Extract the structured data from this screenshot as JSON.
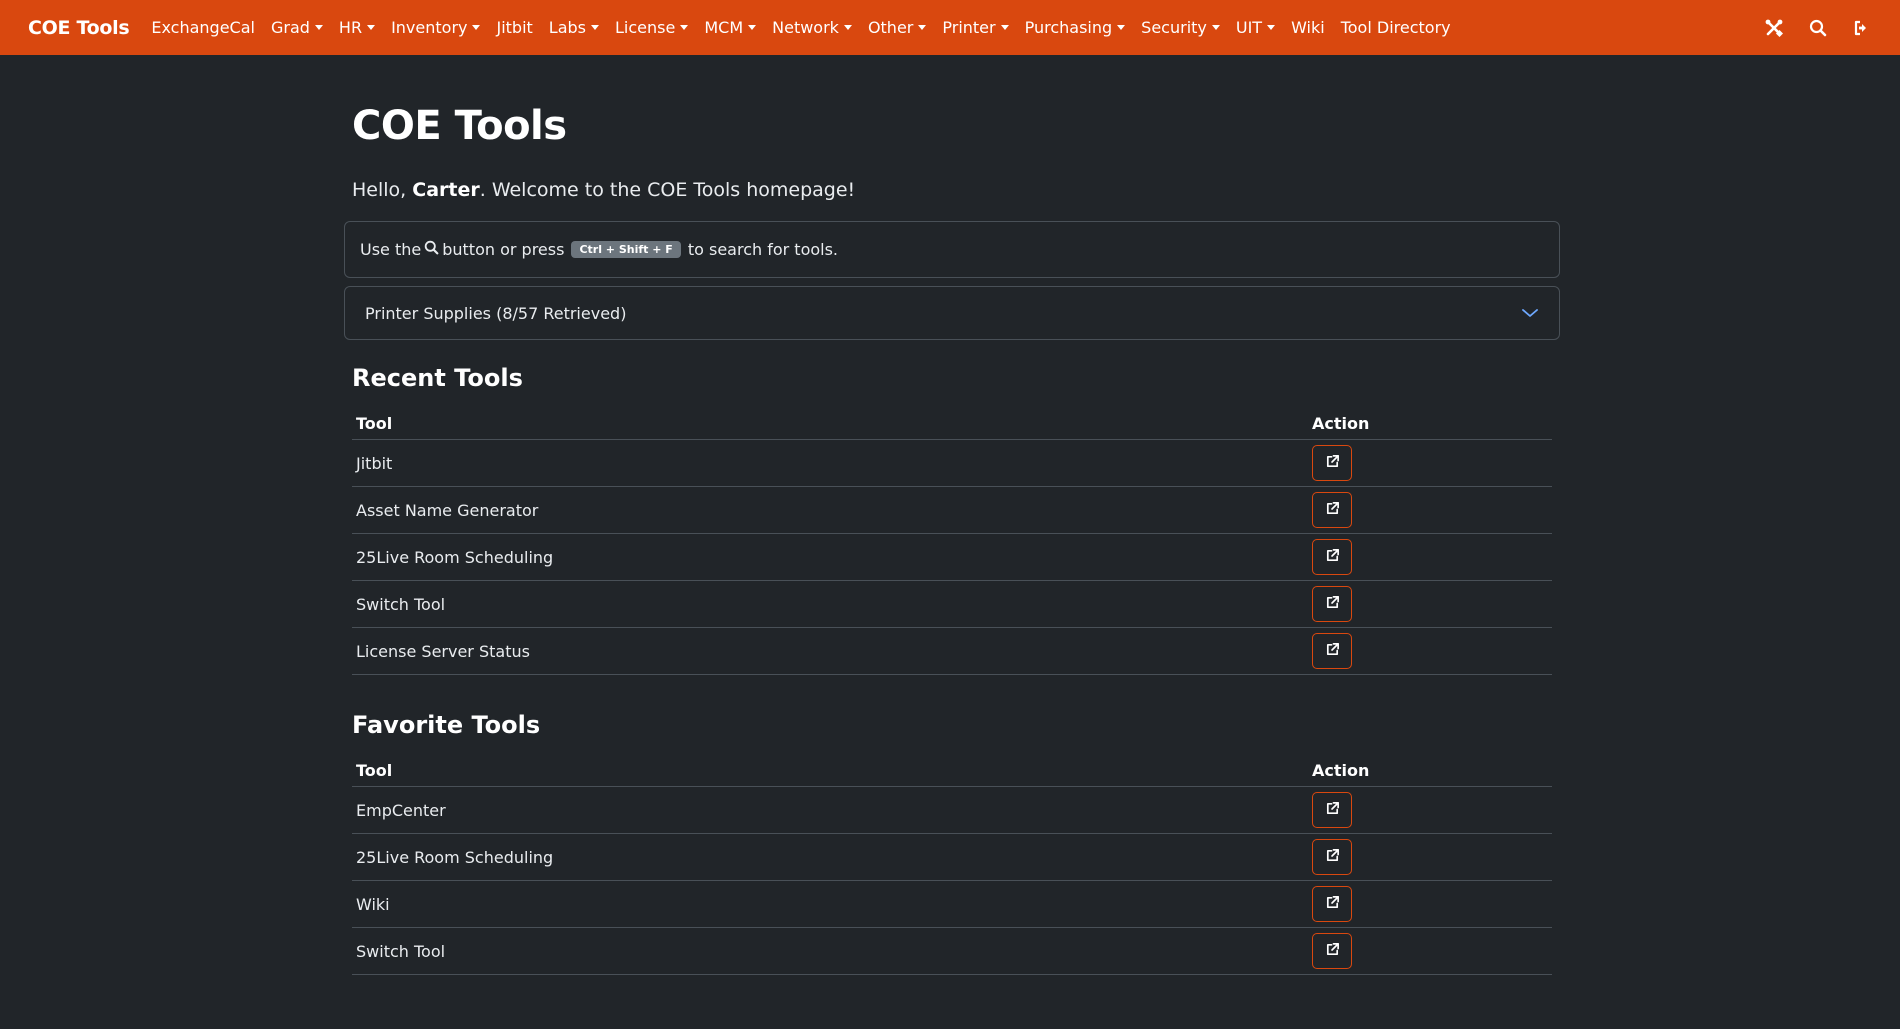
{
  "navbar": {
    "brand": "COE Tools",
    "items": [
      {
        "label": "ExchangeCal",
        "dropdown": false
      },
      {
        "label": "Grad",
        "dropdown": true
      },
      {
        "label": "HR",
        "dropdown": true
      },
      {
        "label": "Inventory",
        "dropdown": true
      },
      {
        "label": "Jitbit",
        "dropdown": false
      },
      {
        "label": "Labs",
        "dropdown": true
      },
      {
        "label": "License",
        "dropdown": true
      },
      {
        "label": "MCM",
        "dropdown": true
      },
      {
        "label": "Network",
        "dropdown": true
      },
      {
        "label": "Other",
        "dropdown": true
      },
      {
        "label": "Printer",
        "dropdown": true
      },
      {
        "label": "Purchasing",
        "dropdown": true
      },
      {
        "label": "Security",
        "dropdown": true
      },
      {
        "label": "UIT",
        "dropdown": true
      },
      {
        "label": "Wiki",
        "dropdown": false
      },
      {
        "label": "Tool Directory",
        "dropdown": false
      }
    ],
    "right_icons": [
      "tools-icon",
      "search-icon",
      "sign-out-icon"
    ]
  },
  "page": {
    "title": "COE Tools",
    "welcome_prefix": "Hello, ",
    "user_name": "Carter",
    "welcome_suffix": ". Welcome to the COE Tools homepage!"
  },
  "search_tip": {
    "prefix": "Use the",
    "middle": "button or press",
    "shortcut": "Ctrl + Shift + F",
    "suffix": "to search for tools."
  },
  "accordion": {
    "label": "Printer Supplies (8/57 Retrieved)"
  },
  "recent": {
    "title": "Recent Tools",
    "col_tool": "Tool",
    "col_action": "Action",
    "rows": [
      "Jitbit",
      "Asset Name Generator",
      "25Live Room Scheduling",
      "Switch Tool",
      "License Server Status"
    ]
  },
  "favorites": {
    "title": "Favorite Tools",
    "col_tool": "Tool",
    "col_action": "Action",
    "rows": [
      "EmpCenter",
      "25Live Room Scheduling",
      "Wiki",
      "Switch Tool"
    ]
  },
  "colors": {
    "accent": "#d9480f",
    "background": "#212529",
    "border": "#495057"
  }
}
